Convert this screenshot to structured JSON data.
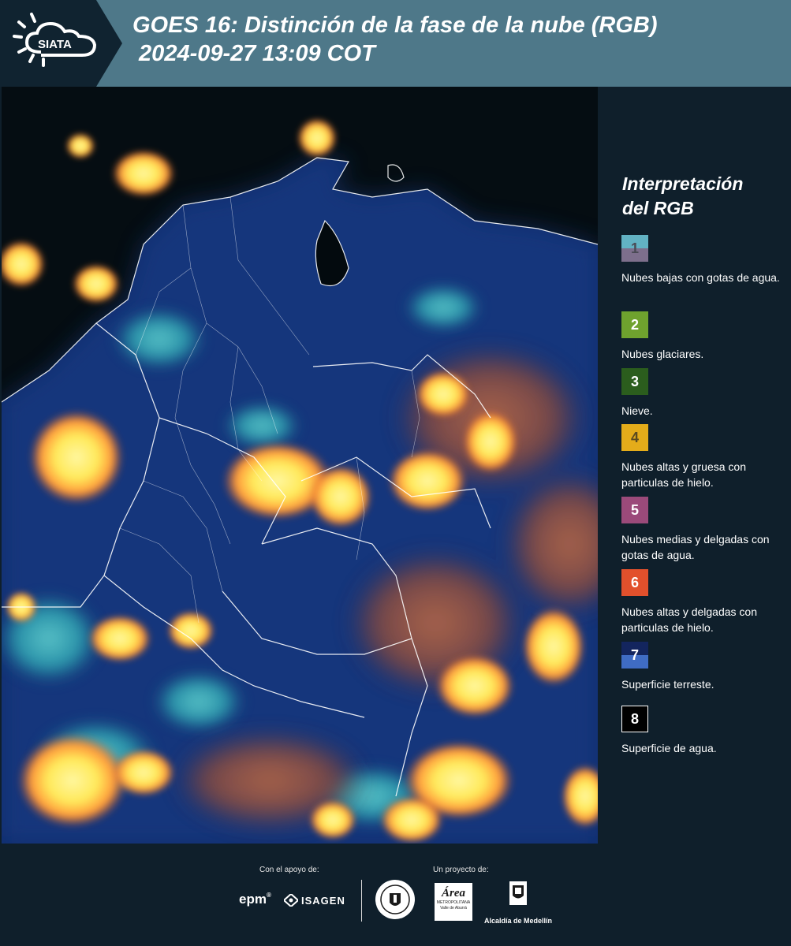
{
  "header": {
    "brand": "SIATA",
    "title_line1": "GOES 16: Distinción de la fase de la nube (RGB)",
    "title_line2": " 2024-09-27 13:09 COT"
  },
  "map": {
    "icon": "satellite-cloud-phase-map"
  },
  "legend": {
    "title_line1": "Interpretación",
    "title_line2": "del RGB",
    "items": [
      {
        "number": "1",
        "label": "Nubes bajas con gotas de agua.",
        "color_top": "#62b2c3",
        "color_bottom": "#7d6f8c",
        "text_color": "#4a4a55"
      },
      {
        "number": "2",
        "label": "Nubes glaciares.",
        "color_top": "#6fa22e",
        "color_bottom": "#6fa22e",
        "text_color": "#ffffff"
      },
      {
        "number": "3",
        "label": "Nieve.",
        "color_top": "#2b5d1d",
        "color_bottom": "#2b5d1d",
        "text_color": "#ffffff"
      },
      {
        "number": "4",
        "label": "Nubes altas y gruesa con particulas de hielo.",
        "color_top": "#e4ac1a",
        "color_bottom": "#e4ac1a",
        "text_color": "#5a4a20"
      },
      {
        "number": "5",
        "label": "Nubes medias y delgadas con gotas de agua.",
        "color_top": "#9b4a7a",
        "color_bottom": "#9b4a7a",
        "text_color": "#ffffff"
      },
      {
        "number": "6",
        "label": "Nubes altas y delgadas con particulas de hielo.",
        "color_top": "#e2502c",
        "color_bottom": "#e2502c",
        "text_color": "#ffffff"
      },
      {
        "number": "7",
        "label": "Superficie terreste.",
        "color_top": "#13255e",
        "color_bottom": "#3f6cc4",
        "text_color": "#ffffff"
      },
      {
        "number": "8",
        "label": "Superficie de agua.",
        "color_top": "#000000",
        "color_bottom": "#000000",
        "text_color": "#ffffff"
      }
    ]
  },
  "footer": {
    "support_label": "Con el apoyo de:",
    "project_label": "Un proyecto de:",
    "epm": "epm",
    "isagen": "ISAGEN",
    "area_name": "Área",
    "area_sub1": "METROPOLITANA",
    "area_sub2": "Valle de Aburrá",
    "alcaldia": "Alcaldía de Medellín"
  }
}
